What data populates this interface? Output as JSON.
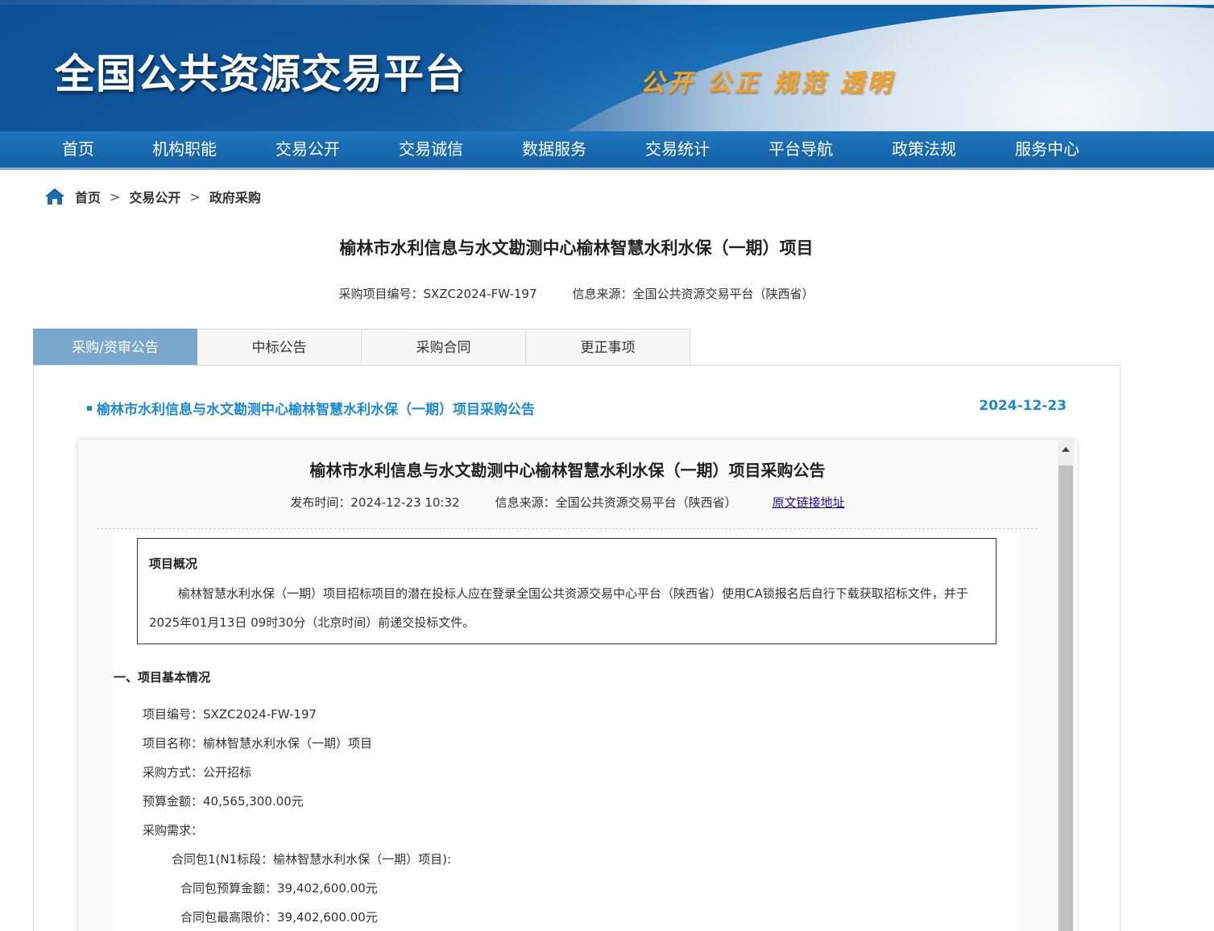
{
  "header": {
    "site_title": "全国公共资源交易平台",
    "slogan": "公开 公正 规范 透明"
  },
  "nav": {
    "items": [
      "首页",
      "机构职能",
      "交易公开",
      "交易诚信",
      "数据服务",
      "交易统计",
      "平台导航",
      "政策法规",
      "服务中心"
    ]
  },
  "breadcrumb": {
    "home_icon": "home-icon",
    "items": [
      "首页",
      "交易公开",
      "政府采购"
    ],
    "separator": ">"
  },
  "project": {
    "title": "榆林市水利信息与水文勘测中心榆林智慧水利水保（一期）项目",
    "code_line": "采购项目编号：SXZC2024-FW-197",
    "source_line": "信息来源：全国公共资源交易平台（陕西省）"
  },
  "tabs": [
    {
      "label": "采购/资审公告",
      "active": true
    },
    {
      "label": "中标公告",
      "active": false
    },
    {
      "label": "采购合同",
      "active": false
    },
    {
      "label": "更正事项",
      "active": false
    }
  ],
  "notice": {
    "link_text": "榆林市水利信息与水文勘测中心榆林智慧水利水保（一期）项目采购公告",
    "date": "2024-12-23"
  },
  "document": {
    "title": "榆林市水利信息与水文勘测中心榆林智慧水利水保（一期）项目采购公告",
    "publish_time": "发布时间：2024-12-23 10:32",
    "source": "信息来源：全国公共资源交易平台（陕西省）",
    "original_link": "原文链接地址",
    "overview_heading": "项目概况",
    "overview_text": "榆林智慧水利水保（一期）项目招标项目的潜在投标人应在登录全国公共资源交易中心平台（陕西省）使用CA锁报名后自行下载获取招标文件，并于 2025年01月13日 09时30分（北京时间）前递交投标文件。",
    "section1_heading": "一、项目基本情况",
    "project_code": "项目编号：SXZC2024-FW-197",
    "project_name": "项目名称：榆林智慧水利水保（一期）项目",
    "procurement_method": "采购方式：公开招标",
    "budget": "预算金额：40,565,300.00元",
    "requirement_label": "采购需求：",
    "package_line": "合同包1(N1标段：榆林智慧水利水保（一期）项目):",
    "package_budget": "合同包预算金额：39,402,600.00元",
    "package_max": "合同包最高限价：39,402,600.00元"
  },
  "colors": {
    "nav_bg": "#1b6cb3",
    "tab_active": "#7aa8cd",
    "link_blue": "#1c8ad6",
    "slogan": "#f2a323"
  }
}
